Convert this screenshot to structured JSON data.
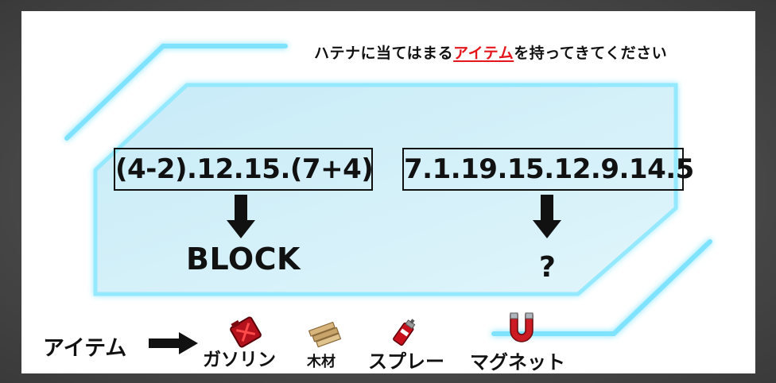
{
  "header": {
    "prefix": "ハテナに当てはまる",
    "highlight": "アイテム",
    "suffix": "を持ってきてください"
  },
  "puzzle": {
    "left_code": "(4-2).12.15.(7+4)",
    "left_answer": "BLOCK",
    "right_code": "7.1.19.15.12.9.14.5",
    "right_answer": "?"
  },
  "items_row": {
    "label": "アイテム",
    "items": [
      {
        "name": "ガソリン",
        "icon": "gasoline-can-icon"
      },
      {
        "name": "木材",
        "icon": "wood-planks-icon"
      },
      {
        "name": "スプレー",
        "icon": "spray-can-icon"
      },
      {
        "name": "マグネット",
        "icon": "magnet-icon"
      }
    ]
  },
  "colors": {
    "highlight": "#e4161b",
    "glow": "#7fe3ff",
    "panel_fill": "#cdeef8"
  }
}
